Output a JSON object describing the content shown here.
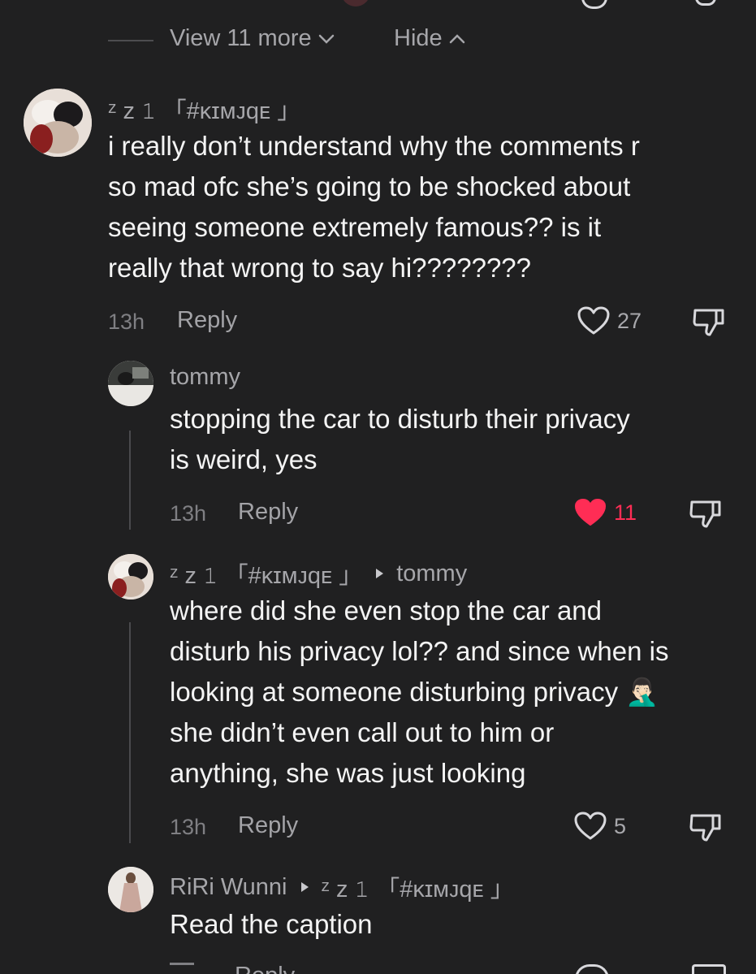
{
  "thread_controls": {
    "view_more": "View 11 more",
    "hide": "Hide"
  },
  "comments": [
    {
      "username": "ᶻ z 𝟷 「#ᴋɪᴍᴊqᴇ 」",
      "text_lines": [
        "i really don’t understand why the comments r",
        "so mad ofc she’s going to be shocked about",
        "seeing someone extremely famous?? is it",
        "really that wrong to say hi????????"
      ],
      "time": "13h",
      "reply_label": "Reply",
      "likes": "27",
      "liked": false
    },
    {
      "username": "tommy",
      "text_lines": [
        "stopping the car to disturb their privacy",
        "is weird, yes"
      ],
      "time": "13h",
      "reply_label": "Reply",
      "likes": "11",
      "liked": true
    },
    {
      "username": "ᶻ z 𝟷 「#ᴋɪᴍᴊqᴇ 」",
      "reply_to": "tommy",
      "text_lines": [
        "where did she even stop the car and",
        "disturb his privacy lol?? and since when is",
        "looking at someone disturbing privacy 🤦🏻‍♂️",
        "she didn’t even call out to him or",
        "anything, she was just looking"
      ],
      "time": "13h",
      "reply_label": "Reply",
      "likes": "5",
      "liked": false
    },
    {
      "username": "RiRi Wunni",
      "reply_to": "ᶻ z 𝟷 「#ᴋɪᴍᴊqᴇ 」",
      "text_lines": [
        "Read the caption"
      ],
      "reply_label": "Reply"
    }
  ],
  "colors": {
    "background": "#202021",
    "like_red": "#ff2d55",
    "muted": "#8f8f93"
  }
}
